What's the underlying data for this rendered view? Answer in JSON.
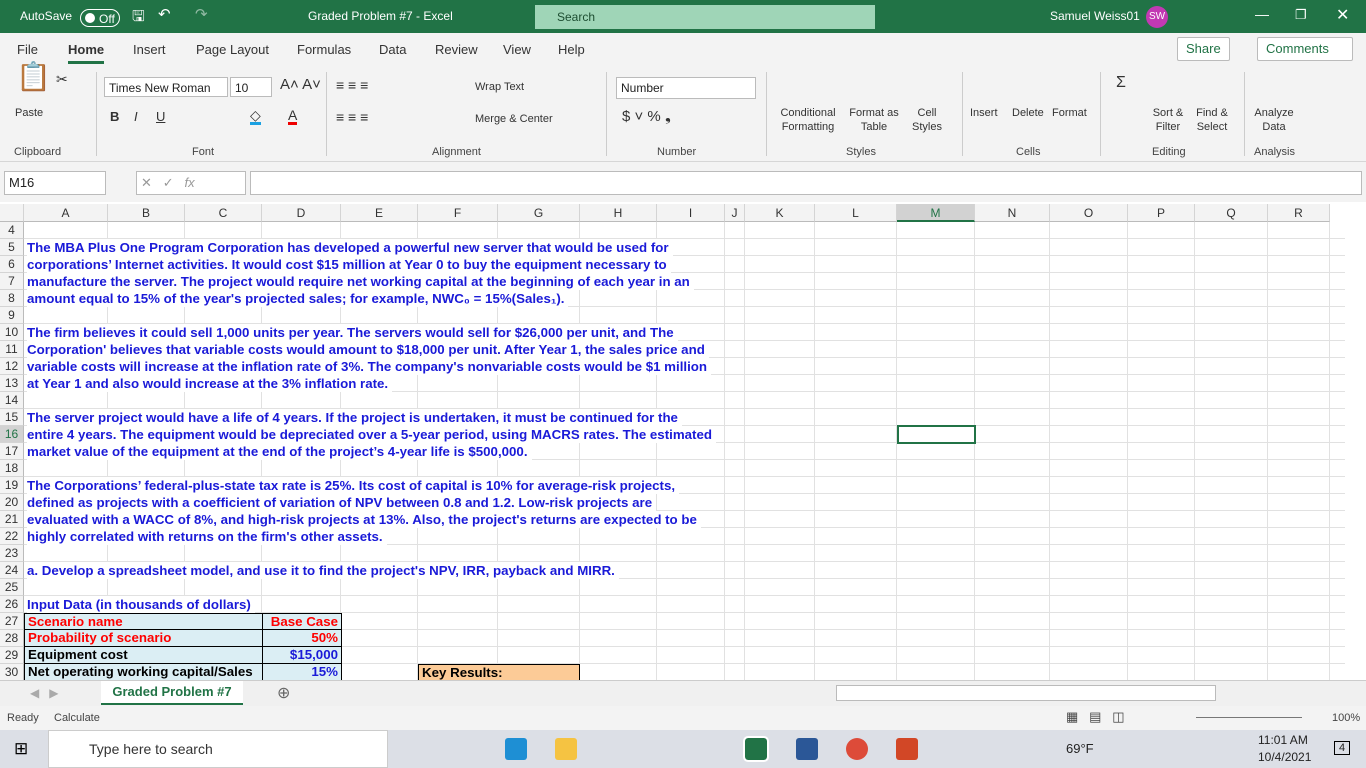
{
  "titlebar": {
    "autosave": "AutoSave",
    "toggle": "Off",
    "title": "Graded Problem #7  -  Excel",
    "search": "Search",
    "user": "Samuel Weiss01",
    "initials": "SW"
  },
  "tabs": [
    "File",
    "Home",
    "Insert",
    "Page Layout",
    "Formulas",
    "Data",
    "Review",
    "View",
    "Help"
  ],
  "share": "Share",
  "comments": "Comments",
  "ribbon": {
    "paste": "Paste",
    "font_name": "Times New Roman",
    "font_size": "10",
    "wrap": "Wrap Text",
    "merge": "Merge & Center",
    "number_format": "Number",
    "cond": "Conditional Formatting",
    "fmt_table": "Format as Table",
    "cell_styles": "Cell Styles",
    "insert": "Insert",
    "delete": "Delete",
    "format": "Format",
    "sort": "Sort & Filter",
    "find": "Find & Select",
    "analyze": "Analyze Data",
    "groups": [
      "Clipboard",
      "Font",
      "Alignment",
      "Number",
      "Styles",
      "Cells",
      "Editing",
      "Analysis"
    ]
  },
  "formula_bar": {
    "name_box": "M16",
    "fx": "fx",
    "value": ""
  },
  "columns": [
    "A",
    "B",
    "C",
    "D",
    "E",
    "F",
    "G",
    "H",
    "I",
    "J",
    "K",
    "L",
    "M",
    "N",
    "O",
    "P",
    "Q",
    "R"
  ],
  "rows": [
    "4",
    "5",
    "6",
    "7",
    "8",
    "9",
    "10",
    "11",
    "12",
    "13",
    "14",
    "15",
    "16",
    "17",
    "18",
    "19",
    "20",
    "21",
    "22",
    "23",
    "24",
    "25",
    "26",
    "27",
    "28",
    "29",
    "30"
  ],
  "text_lines": {
    "5": "The MBA Plus One Program Corporation  has developed a powerful new server that would be used for",
    "6": "corporations’ Internet activities.  It would cost $15 million at Year 0 to buy the equipment necessary to",
    "7": "manufacture the server.  The project would require net working capital at the beginning of each year in an",
    "8": "amount equal to 15% of the year's projected sales; for example, NWC₀ = 15%(Sales₁).",
    "10": "The firm believes it could sell 1,000 units per year. The servers would sell for $26,000 per unit, and The",
    "11": "Corporation' believes that variable costs would amount to $18,000 per unit.  After Year 1, the sales price and",
    "12": "variable costs will increase at the inflation rate of 3%.  The company's nonvariable costs would be $1 million",
    "13": "at Year 1 and also would increase at the 3% inflation rate.",
    "15": "The server project would have a life of 4 years.  If the project is undertaken, it must be continued for the",
    "16": "entire 4 years. The equipment would be depreciated over a 5-year period, using MACRS rates.  The estimated",
    "17": "market value of the equipment at the end of the project’s 4-year life is $500,000.",
    "19": "    The Corporations’ federal-plus-state tax rate is 25%.  Its cost of capital is 10% for average-risk projects,",
    "20": "defined as projects with a coefficient of variation of NPV between 0.8 and 1.2.  Low-risk projects are",
    "21": "evaluated with a WACC of 8%, and high-risk projects at 13%. Also, the project's returns are expected to be",
    "22": "highly correlated with returns on the firm's other assets.",
    "24": "a.  Develop a spreadsheet model, and use it to find the project's NPV, IRR, payback and MIRR.",
    "26": "Input Data (in thousands of dollars)"
  },
  "input_table": [
    {
      "label": "Scenario name",
      "value": "Base Case",
      "color": "#ff0000"
    },
    {
      "label": "Probability of scenario",
      "value": "50%",
      "color": "#ff0000"
    },
    {
      "label": "Equipment  cost",
      "value": "$15,000",
      "color": "#000000"
    },
    {
      "label": "Net operating working capital/Sales",
      "value": "15%",
      "color": "#000000"
    }
  ],
  "key_results": "Key Results:",
  "sheet_tab": "Graded Problem #7",
  "status": {
    "ready": "Ready",
    "calculate": "Calculate",
    "zoom": "100%"
  },
  "taskbar": {
    "search": "Type here to search",
    "weather": "69°F",
    "time": "11:01 AM",
    "date": "10/4/2021",
    "notif": "4"
  },
  "colors": {
    "excel_green": "#217346",
    "text_blue": "#1a1ad8"
  }
}
